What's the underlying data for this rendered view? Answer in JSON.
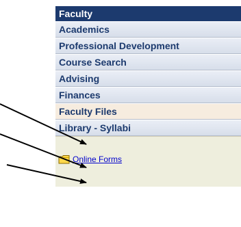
{
  "nav": {
    "header": "Faculty",
    "items": [
      {
        "label": "Academics"
      },
      {
        "label": "Professional Development"
      },
      {
        "label": "Course Search"
      },
      {
        "label": "Advising"
      },
      {
        "label": "Finances"
      },
      {
        "label": "Faculty Files"
      },
      {
        "label": "Library - Syllabi"
      }
    ],
    "link": {
      "label": "Online Forms",
      "icon": "folder-icon"
    }
  },
  "colors": {
    "header_bg": "#1c3a6e",
    "item_text": "#1c3a6e",
    "active_item_bg": "#f6ecdf",
    "panel_bg": "#eeeedd",
    "link_color": "#0000cc",
    "folder_color": "#ffd84a"
  }
}
